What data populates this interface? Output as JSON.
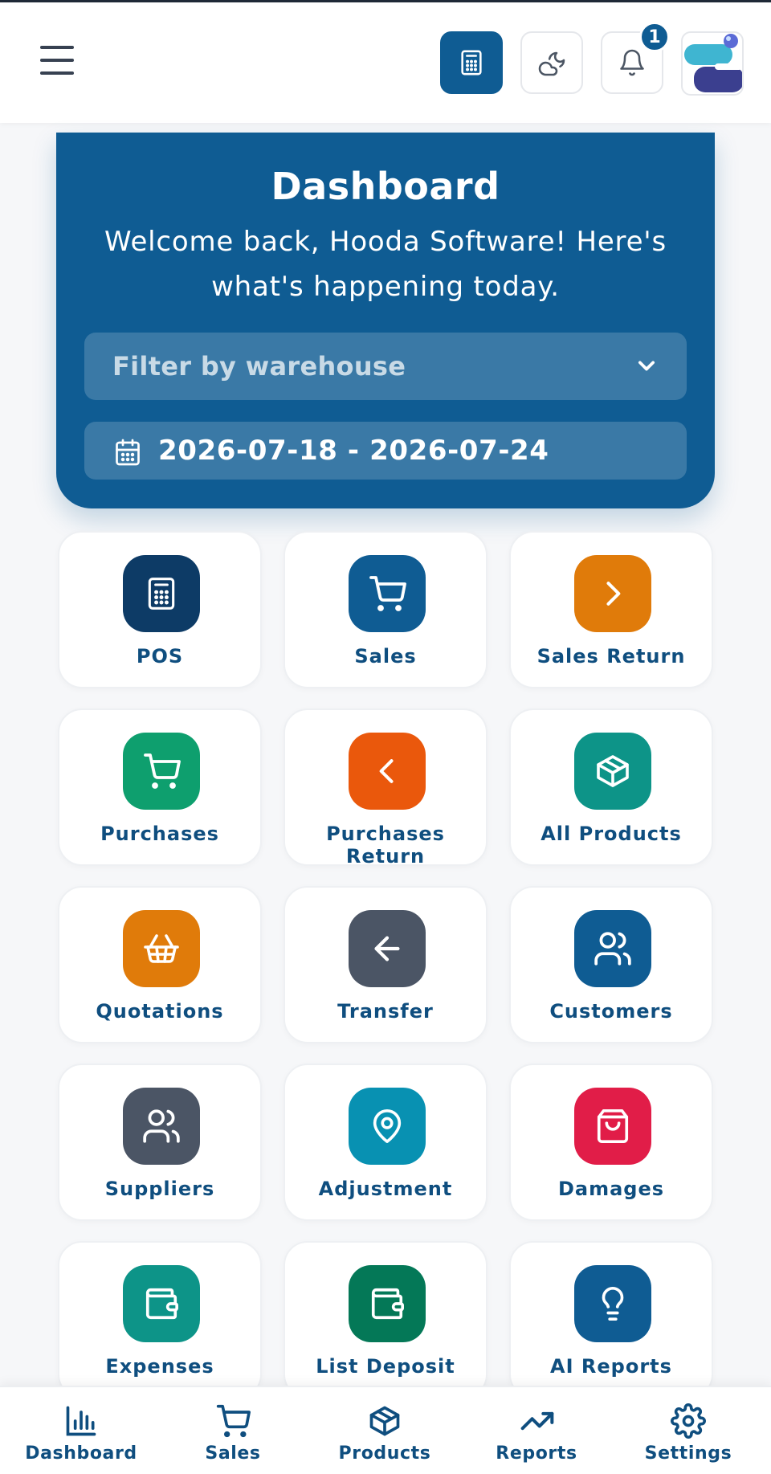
{
  "header": {
    "menu_icon": "hamburger-menu-icon",
    "calculator_icon": "calculator-icon",
    "theme_icon": "moon-cloud-icon",
    "notification_icon": "bell-icon",
    "notification_count": "1",
    "accent_color": "#0f5c93"
  },
  "hero": {
    "title": "Dashboard",
    "subtitle": "Welcome back, Hooda Software! Here's what's happening today.",
    "warehouse_placeholder": "Filter by warehouse",
    "date_range": "2026-07-18 - 2026-07-24",
    "background_color": "#0f5c93"
  },
  "tiles": [
    {
      "label": "POS",
      "icon": "calculator-icon",
      "color": "#0d3b66"
    },
    {
      "label": "Sales",
      "icon": "cart-icon",
      "color": "#0f5c93"
    },
    {
      "label": "Sales Return",
      "icon": "chevron-right-icon",
      "color": "#e07b0a"
    },
    {
      "label": "Purchases",
      "icon": "cart-icon",
      "color": "#0e9f6e"
    },
    {
      "label": "Purchases Return",
      "icon": "chevron-left-icon",
      "color": "#ea580c"
    },
    {
      "label": "All Products",
      "icon": "box-icon",
      "color": "#0d9488"
    },
    {
      "label": "Quotations",
      "icon": "basket-icon",
      "color": "#e07b0a"
    },
    {
      "label": "Transfer",
      "icon": "arrow-left-icon",
      "color": "#4b5565"
    },
    {
      "label": "Customers",
      "icon": "users-icon",
      "color": "#0f5c93"
    },
    {
      "label": "Suppliers",
      "icon": "users-icon",
      "color": "#4b5565"
    },
    {
      "label": "Adjustment",
      "icon": "map-pin-icon",
      "color": "#0891b2"
    },
    {
      "label": "Damages",
      "icon": "shopping-bag-icon",
      "color": "#e11d48"
    },
    {
      "label": "Expenses",
      "icon": "wallet-icon",
      "color": "#0d9488"
    },
    {
      "label": "List Deposit",
      "icon": "wallet-icon",
      "color": "#047857"
    },
    {
      "label": "AI Reports",
      "icon": "lightbulb-icon",
      "color": "#0f5c93"
    }
  ],
  "bottom_nav": [
    {
      "label": "Dashboard",
      "icon": "bar-chart-icon"
    },
    {
      "label": "Sales",
      "icon": "cart-icon"
    },
    {
      "label": "Products",
      "icon": "box-icon"
    },
    {
      "label": "Reports",
      "icon": "trending-up-icon"
    },
    {
      "label": "Settings",
      "icon": "gear-icon"
    }
  ]
}
